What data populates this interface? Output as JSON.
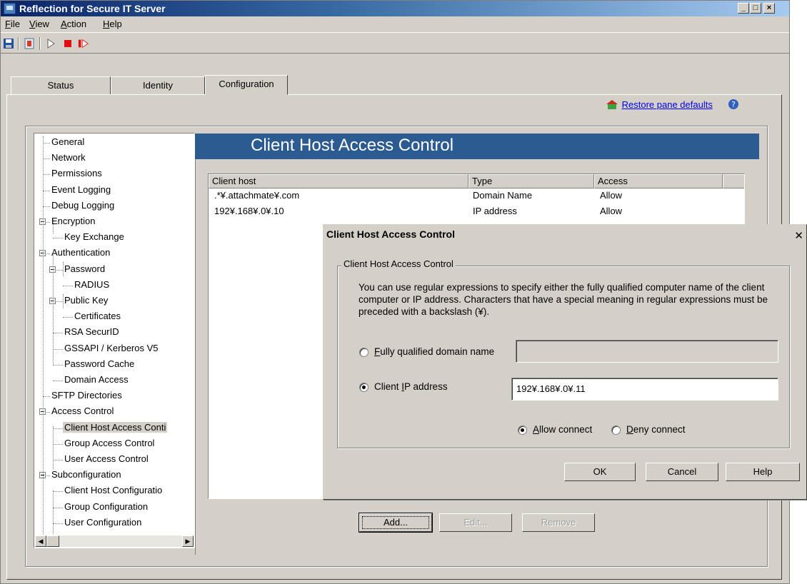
{
  "window": {
    "title": "Reflection for Secure IT Server"
  },
  "menu": {
    "items": [
      "File",
      "View",
      "Action",
      "Help"
    ]
  },
  "toolbar": {
    "icons": [
      "save-icon",
      "settings-icon",
      "start-icon",
      "stop-icon",
      "restart-icon"
    ]
  },
  "tabs": [
    "Status",
    "Identity",
    "Configuration"
  ],
  "restore_link": "Restore pane defaults",
  "tree": {
    "items": [
      "General",
      "Network",
      "Permissions",
      "Event Logging",
      "Debug Logging",
      "Encryption",
      "Key Exchange",
      "Authentication",
      "Password",
      "RADIUS",
      "Public Key",
      "Certificates",
      "RSA SecurID",
      "GSSAPI / Kerberos V5",
      "Password Cache",
      "Domain Access",
      "SFTP Directories",
      "Access Control",
      "Client Host Access Conti",
      "Group Access Control",
      "User Access Control",
      "Subconfiguration",
      "Client Host Configuratio",
      "Group Configuration",
      "User Configuration"
    ]
  },
  "pane": {
    "title": "Client Host Access Control",
    "columns": [
      "Client host",
      "Type",
      "Access"
    ],
    "rows": [
      [
        ".*¥.attachmate¥.com",
        "Domain Name",
        "Allow"
      ],
      [
        "192¥.168¥.0¥.10",
        "IP address",
        "Allow"
      ]
    ],
    "buttons": {
      "add": "Add...",
      "edit": "Edit...",
      "remove": "Remove"
    }
  },
  "dialog": {
    "title": "Client Host Access Control",
    "group_label": "Client Host Access Control",
    "description": "You can use regular expressions to specify either the fully qualified computer name of the client computer or IP address.  Characters that have a special meaning in regular expressions must be preceded with a backslash (¥).",
    "fqdn_label": "Fully qualified domain name",
    "fqdn_value": "",
    "ip_label": "Client IP address",
    "ip_value": "192¥.168¥.0¥.11",
    "allow_label": "Allow connect",
    "deny_label": "Deny connect",
    "ok": "OK",
    "cancel": "Cancel",
    "help": "Help"
  }
}
